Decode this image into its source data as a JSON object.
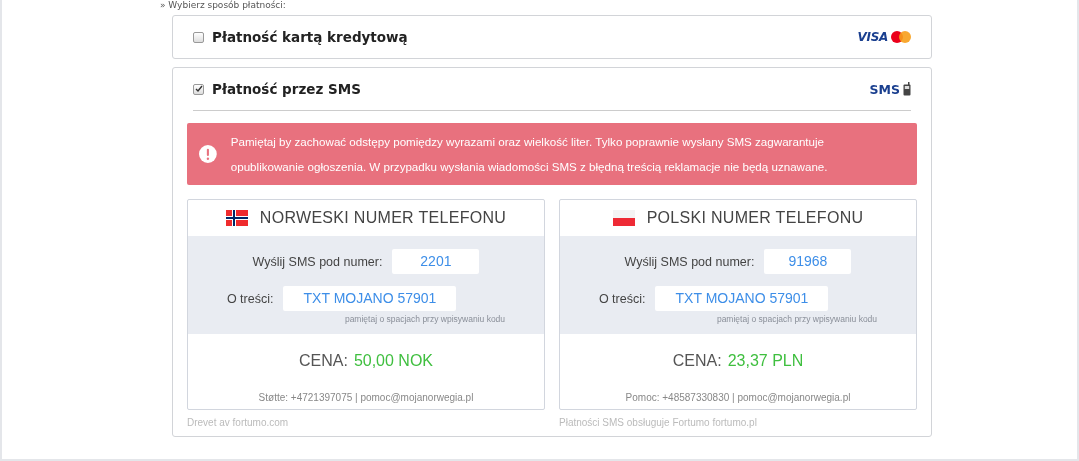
{
  "heading": "» Wybierz sposób płatności:",
  "methods": [
    {
      "label": "Płatność kartą kredytową",
      "selected": false,
      "kind": "card",
      "logo_text": "VISA"
    },
    {
      "label": "Płatność przez SMS",
      "selected": true,
      "kind": "sms",
      "logo_text": "SMS"
    }
  ],
  "alert": {
    "text": "Pamiętaj by zachować odstępy pomiędzy wyrazami oraz wielkość liter. Tylko poprawnie wysłany SMS zagwarantuje opublikowanie ogłoszenia. W przypadku wysłania wiadomości SMS z błędną treścią reklamacje nie będą uznawane."
  },
  "numbers": [
    {
      "kind": "norway",
      "title": "NORWESKI NUMER TELEFONU",
      "number_label": "Wyślij SMS pod numer:",
      "number": "2201",
      "content_label": "O treści:",
      "content": "TXT MOJANO 57901",
      "hint": "pamiętaj o spacjach przy wpisywaniu kodu",
      "price_label": "CENA:",
      "price": "50,00 NOK",
      "support": "Støtte: +4721397075 | pomoc@mojanorwegia.pl",
      "provider": "Drevet av fortumo.com"
    },
    {
      "kind": "poland",
      "title": "POLSKI NUMER TELEFONU",
      "number_label": "Wyślij SMS pod numer:",
      "number": "91968",
      "content_label": "O treści:",
      "content": "TXT MOJANO 57901",
      "hint": "pamiętaj o spacjach przy wpisywaniu kodu",
      "price_label": "CENA:",
      "price": "23,37 PLN",
      "support": "Pomoc: +48587330830 | pomoc@mojanorwegia.pl",
      "provider": "Płatności SMS obsługuje Fortumo fortumo.pl"
    }
  ]
}
